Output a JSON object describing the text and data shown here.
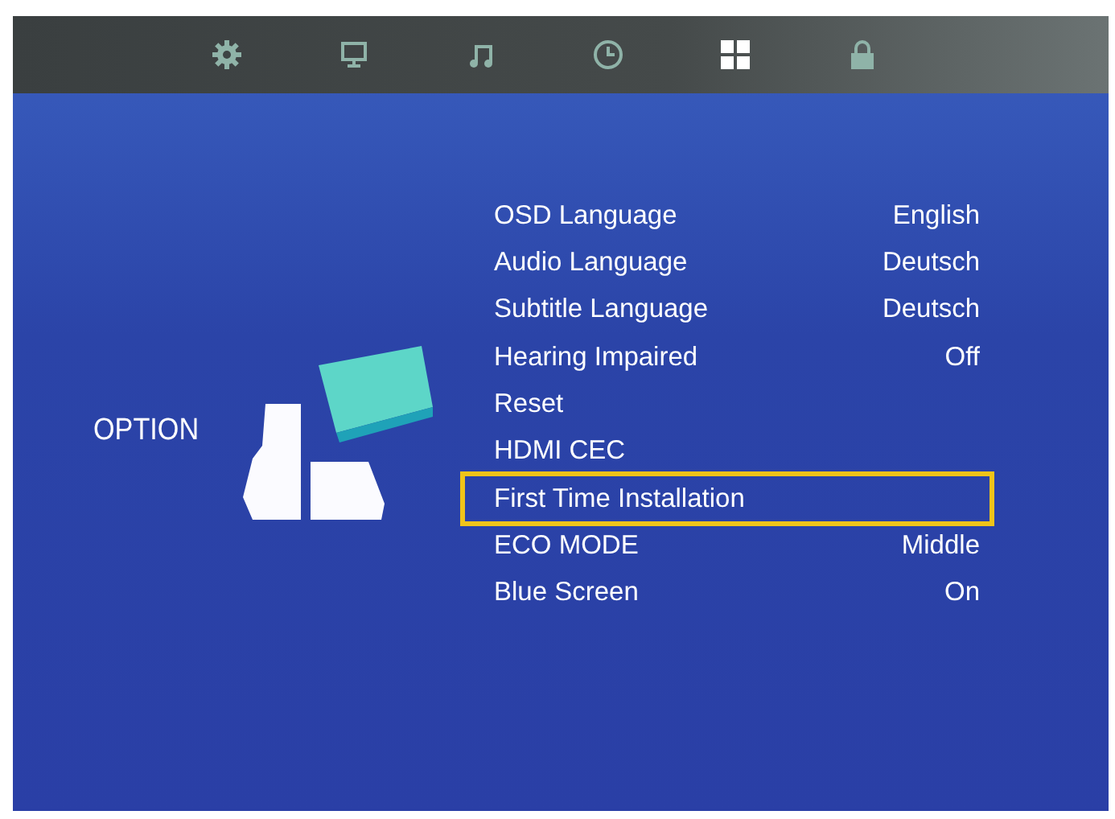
{
  "tabs": [
    {
      "kind": "gear",
      "selected": false
    },
    {
      "kind": "monitor",
      "selected": false
    },
    {
      "kind": "music",
      "selected": false
    },
    {
      "kind": "clock",
      "selected": false
    },
    {
      "kind": "grid",
      "selected": true
    },
    {
      "kind": "lock",
      "selected": false
    }
  ],
  "section": {
    "title": "OPTION"
  },
  "menu": [
    {
      "label": "OSD Language",
      "value": "English",
      "selected": false
    },
    {
      "label": "Audio Language",
      "value": "Deutsch",
      "selected": false
    },
    {
      "label": "Subtitle Language",
      "value": "Deutsch",
      "selected": false
    },
    {
      "label": "Hearing Impaired",
      "value": "Off",
      "selected": false
    },
    {
      "label": "Reset",
      "selected": false
    },
    {
      "label": "HDMI CEC",
      "selected": false
    },
    {
      "label": "First Time Installation",
      "selected": true
    },
    {
      "label": "ECO MODE",
      "value": "Middle",
      "selected": false
    },
    {
      "label": "Blue Screen",
      "value": "On",
      "selected": false
    }
  ]
}
